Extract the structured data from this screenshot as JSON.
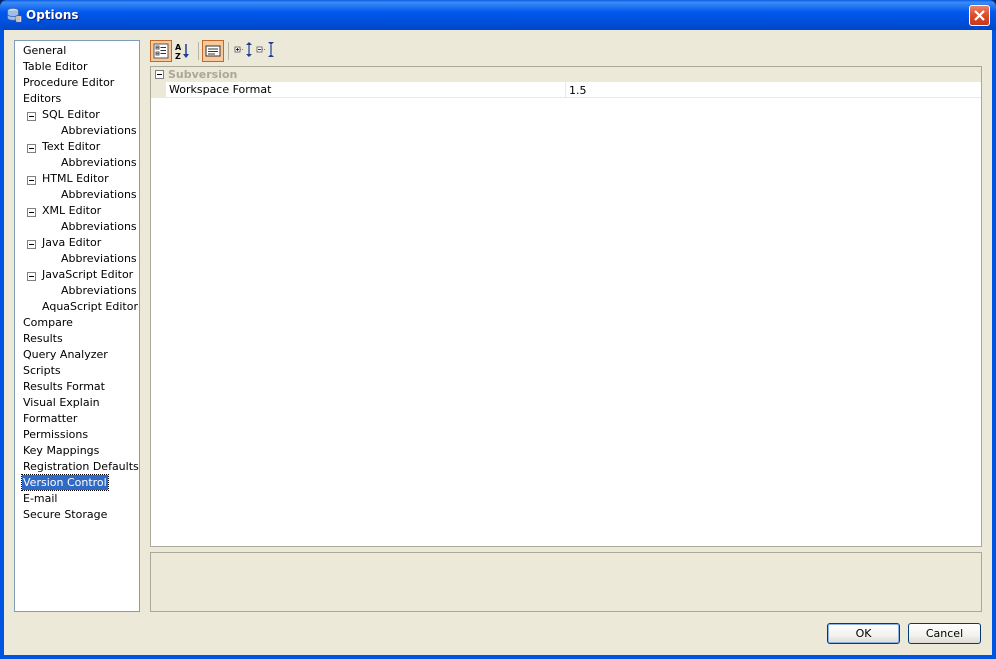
{
  "window": {
    "title": "Options",
    "title_icon": "database-options-icon",
    "close_icon": "close-icon"
  },
  "tree": {
    "items": [
      {
        "label": "General",
        "level": 0
      },
      {
        "label": "Table Editor",
        "level": 0
      },
      {
        "label": "Procedure Editor",
        "level": 0
      },
      {
        "label": "Editors",
        "level": 0
      },
      {
        "label": "SQL Editor",
        "level": 1,
        "expanded": true
      },
      {
        "label": "Abbreviations",
        "level": 2
      },
      {
        "label": "Text Editor",
        "level": 1,
        "expanded": true
      },
      {
        "label": "Abbreviations",
        "level": 2
      },
      {
        "label": "HTML Editor",
        "level": 1,
        "expanded": true
      },
      {
        "label": "Abbreviations",
        "level": 2
      },
      {
        "label": "XML Editor",
        "level": 1,
        "expanded": true
      },
      {
        "label": "Abbreviations",
        "level": 2
      },
      {
        "label": "Java Editor",
        "level": 1,
        "expanded": true
      },
      {
        "label": "Abbreviations",
        "level": 2
      },
      {
        "label": "JavaScript Editor",
        "level": 1,
        "expanded": true
      },
      {
        "label": "Abbreviations",
        "level": 2
      },
      {
        "label": "AquaScript Editor",
        "level": 1
      },
      {
        "label": "Compare",
        "level": 0
      },
      {
        "label": "Results",
        "level": 0
      },
      {
        "label": "Query Analyzer",
        "level": 0
      },
      {
        "label": "Scripts",
        "level": 0
      },
      {
        "label": "Results Format",
        "level": 0
      },
      {
        "label": "Visual Explain",
        "level": 0
      },
      {
        "label": "Formatter",
        "level": 0
      },
      {
        "label": "Permissions",
        "level": 0
      },
      {
        "label": "Key Mappings",
        "level": 0
      },
      {
        "label": "Registration Defaults",
        "level": 0
      },
      {
        "label": "Version Control",
        "level": 0,
        "selected": true
      },
      {
        "label": "E-mail",
        "level": 0
      },
      {
        "label": "Secure Storage",
        "level": 0
      }
    ]
  },
  "toolbar": {
    "buttons": [
      {
        "icon": "categorized-icon",
        "active": true
      },
      {
        "icon": "sort-alphabetical-icon",
        "active": false
      },
      {
        "icon": "property-pages-icon",
        "active": true
      },
      {
        "icon": "expand-all-icon",
        "active": false
      },
      {
        "icon": "collapse-all-icon",
        "active": false
      }
    ]
  },
  "property_grid": {
    "category": "Subversion",
    "properties": [
      {
        "name": "Workspace Format",
        "value": "1.5"
      }
    ]
  },
  "buttons": {
    "ok": "OK",
    "cancel": "Cancel"
  },
  "colors": {
    "title_bar": "#0054e3",
    "selection": "#316ac5",
    "dialog_bg": "#ece9d8",
    "close_button": "#d94c2c"
  }
}
